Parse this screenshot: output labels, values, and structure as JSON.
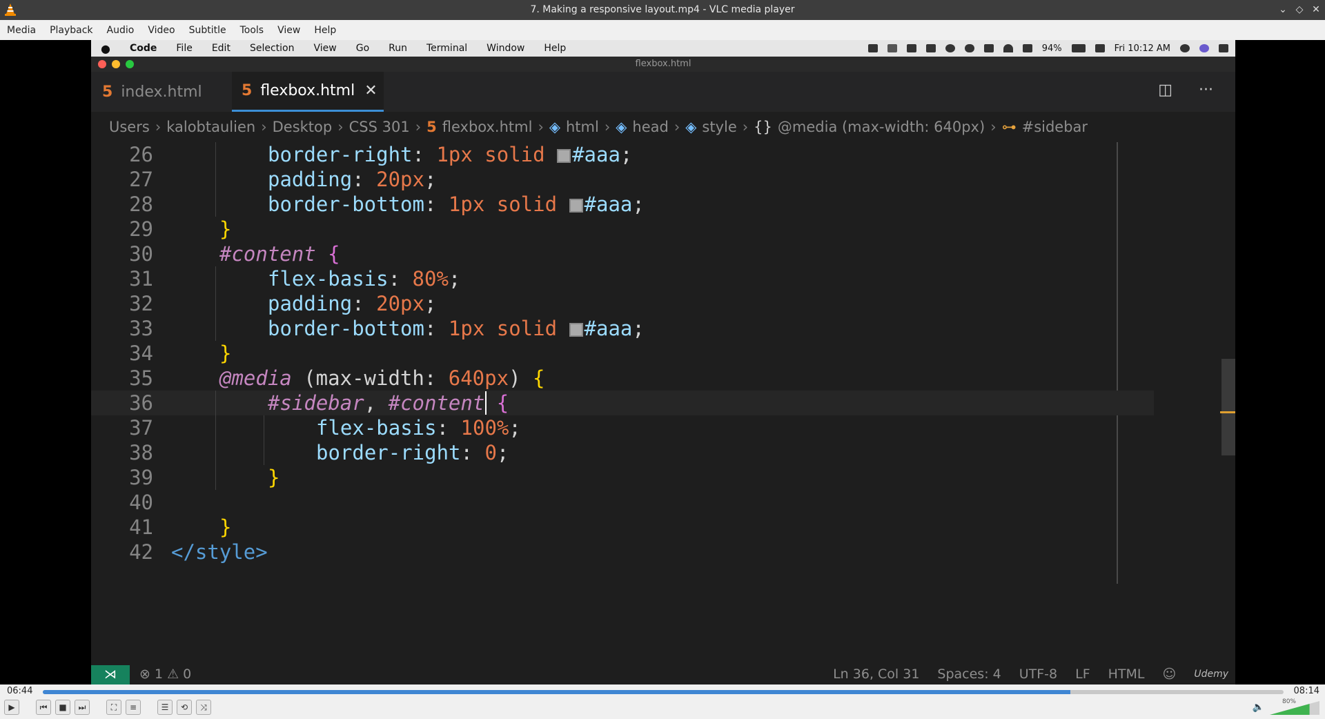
{
  "window": {
    "title": "7. Making a responsive layout.mp4 - VLC media player",
    "controls": [
      "⌄",
      "◇",
      "✕"
    ]
  },
  "menu": [
    "Media",
    "Playback",
    "Audio",
    "Video",
    "Subtitle",
    "Tools",
    "View",
    "Help"
  ],
  "mac_menubar": {
    "apple": "",
    "items": [
      "Code",
      "File",
      "Edit",
      "Selection",
      "View",
      "Go",
      "Run",
      "Terminal",
      "Window",
      "Help"
    ],
    "battery": "94%",
    "clock": "Fri 10:12 AM"
  },
  "vscode": {
    "window_title": "flexbox.html",
    "tabs": [
      {
        "label": "index.html",
        "active": false
      },
      {
        "label": "flexbox.html",
        "active": true
      }
    ],
    "breadcrumb": [
      "Users",
      "kalobtaulien",
      "Desktop",
      "CSS 301",
      "flexbox.html",
      "html",
      "head",
      "style",
      "@media (max-width: 640px)",
      "#sidebar"
    ],
    "lines": [
      {
        "n": "26",
        "indent": 2,
        "tokens": [
          [
            "prop",
            "border-right"
          ],
          [
            "plain",
            ": "
          ],
          [
            "num",
            "1px"
          ],
          [
            "plain",
            " "
          ],
          [
            "num",
            "solid"
          ],
          [
            "plain",
            " "
          ],
          [
            "swatch",
            ""
          ],
          [
            "prop",
            "#aaa"
          ],
          [
            "plain",
            ";"
          ]
        ]
      },
      {
        "n": "27",
        "indent": 2,
        "tokens": [
          [
            "prop",
            "padding"
          ],
          [
            "plain",
            ": "
          ],
          [
            "num",
            "20px"
          ],
          [
            "plain",
            ";"
          ]
        ]
      },
      {
        "n": "28",
        "indent": 2,
        "tokens": [
          [
            "prop",
            "border-bottom"
          ],
          [
            "plain",
            ": "
          ],
          [
            "num",
            "1px"
          ],
          [
            "plain",
            " "
          ],
          [
            "num",
            "solid"
          ],
          [
            "plain",
            " "
          ],
          [
            "swatch",
            ""
          ],
          [
            "prop",
            "#aaa"
          ],
          [
            "plain",
            ";"
          ]
        ]
      },
      {
        "n": "29",
        "indent": 1,
        "tokens": [
          [
            "brace2",
            "}"
          ]
        ]
      },
      {
        "n": "30",
        "indent": 1,
        "tokens": [
          [
            "sel",
            "#content"
          ],
          [
            "plain",
            " "
          ],
          [
            "brace",
            "{"
          ]
        ]
      },
      {
        "n": "31",
        "indent": 2,
        "tokens": [
          [
            "prop",
            "flex-basis"
          ],
          [
            "plain",
            ": "
          ],
          [
            "num",
            "80%"
          ],
          [
            "plain",
            ";"
          ]
        ]
      },
      {
        "n": "32",
        "indent": 2,
        "tokens": [
          [
            "prop",
            "padding"
          ],
          [
            "plain",
            ": "
          ],
          [
            "num",
            "20px"
          ],
          [
            "plain",
            ";"
          ]
        ]
      },
      {
        "n": "33",
        "indent": 2,
        "tokens": [
          [
            "prop",
            "border-bottom"
          ],
          [
            "plain",
            ": "
          ],
          [
            "num",
            "1px"
          ],
          [
            "plain",
            " "
          ],
          [
            "num",
            "solid"
          ],
          [
            "plain",
            " "
          ],
          [
            "swatch",
            ""
          ],
          [
            "prop",
            "#aaa"
          ],
          [
            "plain",
            ";"
          ]
        ]
      },
      {
        "n": "34",
        "indent": 1,
        "tokens": [
          [
            "brace2",
            "}"
          ]
        ]
      },
      {
        "n": "35",
        "indent": 1,
        "tokens": [
          [
            "at",
            "@media"
          ],
          [
            "plain",
            " (max-width: "
          ],
          [
            "num",
            "640px"
          ],
          [
            "plain",
            ") "
          ],
          [
            "brace2",
            "{"
          ]
        ]
      },
      {
        "n": "36",
        "indent": 2,
        "tokens": [
          [
            "sel",
            "#sidebar"
          ],
          [
            "plain",
            ", "
          ],
          [
            "sel",
            "#content"
          ],
          [
            "plain",
            " "
          ],
          [
            "brace",
            "{"
          ]
        ]
      },
      {
        "n": "37",
        "indent": 3,
        "tokens": [
          [
            "prop",
            "flex-basis"
          ],
          [
            "plain",
            ": "
          ],
          [
            "num",
            "100%"
          ],
          [
            "plain",
            ";"
          ]
        ]
      },
      {
        "n": "38",
        "indent": 3,
        "tokens": [
          [
            "prop",
            "border-right"
          ],
          [
            "plain",
            ": "
          ],
          [
            "num",
            "0"
          ],
          [
            "plain",
            ";"
          ]
        ]
      },
      {
        "n": "39",
        "indent": 2,
        "tokens": [
          [
            "brace2",
            "}"
          ]
        ]
      },
      {
        "n": "40",
        "indent": 0,
        "tokens": []
      },
      {
        "n": "41",
        "indent": 1,
        "tokens": [
          [
            "brace2",
            "}"
          ]
        ]
      },
      {
        "n": "42",
        "indent": 0,
        "tokens": [
          [
            "tag",
            "</style>"
          ]
        ]
      }
    ],
    "current_line": "36",
    "status": {
      "remote": "⋊",
      "problems": "⊗ 1 ⚠ 0",
      "position": "Ln 36, Col 31",
      "spaces": "Spaces: 4",
      "encoding": "UTF-8",
      "eol": "LF",
      "language": "HTML",
      "watermark": "Udemy"
    }
  },
  "player": {
    "elapsed": "06:44",
    "total": "08:14",
    "progress": 0.828,
    "volume_label": "80%",
    "volume": 0.8
  }
}
